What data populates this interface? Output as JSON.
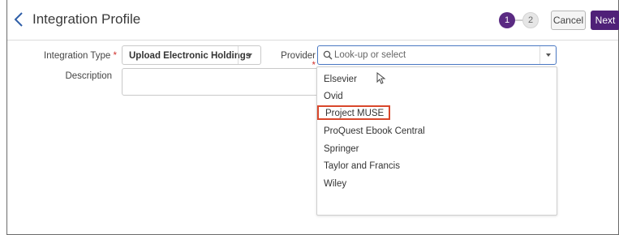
{
  "header": {
    "title": "Integration Profile",
    "steps": [
      "1",
      "2"
    ],
    "cancel_label": "Cancel",
    "next_label": "Next"
  },
  "form": {
    "integration_type": {
      "label": "Integration Type",
      "required_mark": "*",
      "value": "Upload Electronic Holdings"
    },
    "provider": {
      "label": "Provider",
      "required_mark": "*",
      "placeholder": "Look-up or select"
    },
    "description": {
      "label": "Description"
    }
  },
  "provider_dropdown": {
    "options": [
      "Elsevier",
      "Ovid",
      "Project MUSE",
      "ProQuest Ebook Central",
      "Springer",
      "Taylor and Francis",
      "Wiley"
    ],
    "highlighted": "Project MUSE"
  },
  "colors": {
    "accent": "#4f2078",
    "step_active": "#5a2a82",
    "focus_border": "#4a78c2",
    "highlight_border": "#d9472b",
    "required": "#d0312d"
  },
  "icons": [
    "chevron-left-icon",
    "search-icon",
    "caret-down-icon",
    "mouse-cursor-icon"
  ]
}
